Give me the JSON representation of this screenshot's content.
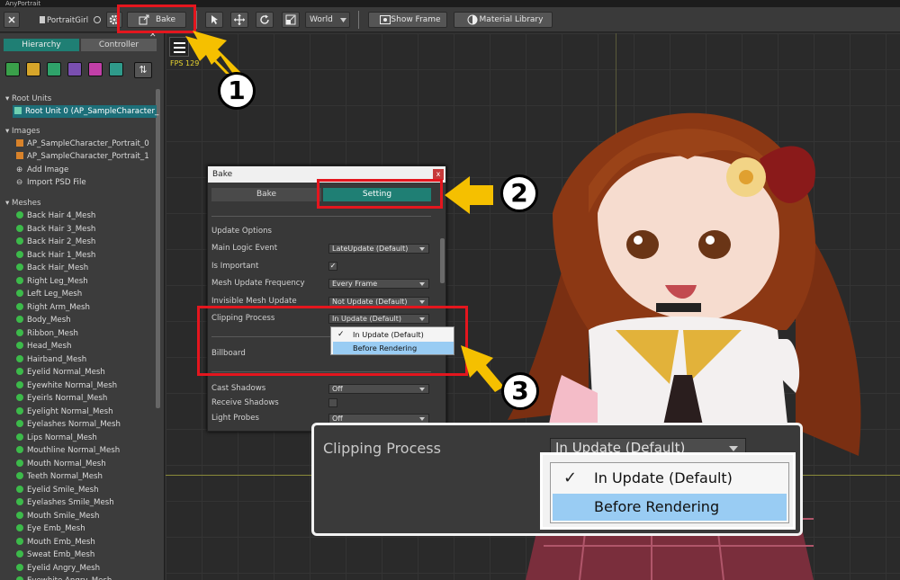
{
  "app": {
    "title": "AnyPortrait"
  },
  "toolbar": {
    "file_name": "PortraitGirl",
    "bake_label": "Bake",
    "space_select": "World",
    "show_frame_label": "Show Frame",
    "material_library_label": "Material Library"
  },
  "sidebar": {
    "tabs": [
      "Hierarchy",
      "Controller"
    ],
    "icon_colors": [
      "#3aa04a",
      "#d6a52a",
      "#2fa36a",
      "#7a4fb0",
      "#c23fa8",
      "#2f9a8a"
    ],
    "root_units_header": "Root Units",
    "root_unit": "Root Unit 0 (AP_SampleCharacter_",
    "images_header": "Images",
    "images": [
      "AP_SampleCharacter_Portrait_0",
      "AP_SampleCharacter_Portrait_1"
    ],
    "add_image": "Add Image",
    "import_psd": "Import PSD File",
    "meshes_header": "Meshes",
    "meshes": [
      "Back Hair 4_Mesh",
      "Back Hair 3_Mesh",
      "Back Hair 2_Mesh",
      "Back Hair 1_Mesh",
      "Back Hair_Mesh",
      "Right Leg_Mesh",
      "Left Leg_Mesh",
      "Right Arm_Mesh",
      "Body_Mesh",
      "Ribbon_Mesh",
      "Head_Mesh",
      "Hairband_Mesh",
      "Eyelid Normal_Mesh",
      "Eyewhite Normal_Mesh",
      "Eyeirls Normal_Mesh",
      "Eyelight Normal_Mesh",
      "Eyelashes Normal_Mesh",
      "Lips Normal_Mesh",
      "Mouthline Normal_Mesh",
      "Mouth Normal_Mesh",
      "Teeth Normal_Mesh",
      "Eyelid Smile_Mesh",
      "Eyelashes Smile_Mesh",
      "Mouth Smile_Mesh",
      "Eye Emb_Mesh",
      "Mouth Emb_Mesh",
      "Sweat Emb_Mesh",
      "Eyelid Angry_Mesh",
      "Eyewhite Angry_Mesh"
    ]
  },
  "viewport": {
    "fps": "FPS 129"
  },
  "bake_dialog": {
    "title": "Bake",
    "close": "x",
    "tabs": [
      "Bake",
      "Setting"
    ],
    "section": "Update Options",
    "main_logic_event": {
      "label": "Main Logic Event",
      "value": "LateUpdate (Default)"
    },
    "is_important": {
      "label": "Is Important",
      "checked": "✓"
    },
    "mesh_update_frequency": {
      "label": "Mesh Update Frequency",
      "value": "Every Frame"
    },
    "invisible_mesh_update": {
      "label": "Invisible Mesh Update",
      "value": "Not Update (Default)"
    },
    "clipping_process": {
      "label": "Clipping Process",
      "value": "In Update (Default)",
      "options": [
        "In Update (Default)",
        "Before Rendering"
      ]
    },
    "billboard": {
      "label": "Billboard"
    },
    "cast_shadows": {
      "label": "Cast Shadows",
      "value": "Off"
    },
    "receive_shadows": {
      "label": "Receive Shadows"
    },
    "light_probes": {
      "label": "Light Probes",
      "value": "Off"
    }
  },
  "callouts": [
    "1",
    "2",
    "3"
  ],
  "zoom": {
    "label": "Clipping Process",
    "value": "In Update (Default)",
    "options": [
      "In Update (Default)",
      "Before Rendering"
    ],
    "check": "✓"
  },
  "colors": {
    "accent": "#1f7f74",
    "highlight": "#e4161e",
    "arrow": "#f5c000",
    "selection": "#99ccf3"
  }
}
